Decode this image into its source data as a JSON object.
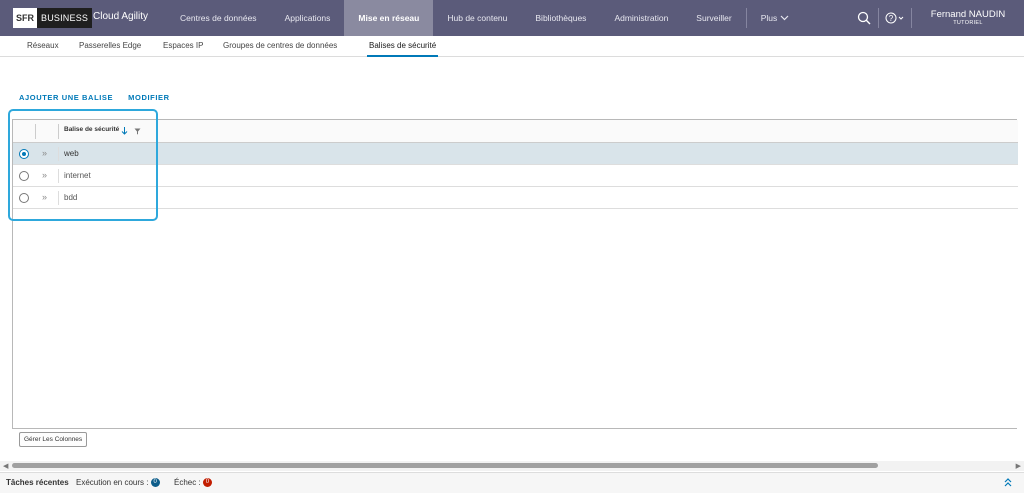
{
  "brand": {
    "sfr": "SFR",
    "business": "BUSINESS",
    "app_title": "Cloud Agility"
  },
  "nav": {
    "items": [
      {
        "label": "Centres de données"
      },
      {
        "label": "Applications"
      },
      {
        "label": "Mise en réseau"
      },
      {
        "label": "Hub de contenu"
      },
      {
        "label": "Bibliothèques"
      },
      {
        "label": "Administration"
      },
      {
        "label": "Surveiller"
      }
    ],
    "more": "Plus",
    "active": "Mise en réseau"
  },
  "user": {
    "name": "Fernand NAUDIN",
    "role": "TUTORIEL"
  },
  "subnav": {
    "items": [
      {
        "label": "Réseaux"
      },
      {
        "label": "Passerelles Edge"
      },
      {
        "label": "Espaces IP"
      },
      {
        "label": "Groupes de centres de données"
      },
      {
        "label": "Balises de sécurité"
      }
    ],
    "active": "Balises de sécurité"
  },
  "actions": {
    "add": "AJOUTER UNE BALISE",
    "edit": "MODIFIER"
  },
  "grid": {
    "column_header": "Balise de sécurité",
    "rows": [
      {
        "name": "web",
        "selected": true
      },
      {
        "name": "internet",
        "selected": false
      },
      {
        "name": "bdd",
        "selected": false
      }
    ],
    "manage_columns": "Gérer Les Colonnes"
  },
  "taskbar": {
    "title": "Tâches récentes",
    "running_label": "Exécution en cours :",
    "running_count": "0",
    "failed_label": "Échec :",
    "failed_count": "0"
  },
  "colors": {
    "topbar": "#5b5b7a",
    "accent": "#0079b8",
    "selected_row": "#d9e4ea",
    "highlight": "#2ea8dc"
  }
}
